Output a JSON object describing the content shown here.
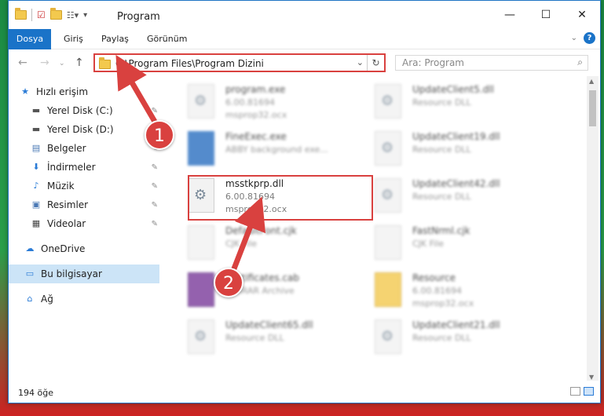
{
  "window": {
    "title": "Program"
  },
  "ribbon": {
    "tabs": [
      "Dosya",
      "Giriş",
      "Paylaş",
      "Görünüm"
    ]
  },
  "address": {
    "path": "C:\\Program Files\\Program Dizini"
  },
  "search": {
    "placeholder": "Ara: Program"
  },
  "sidebar": {
    "items": [
      {
        "label": "Hızlı erişim",
        "icon": "star-icon"
      },
      {
        "label": "Yerel Disk (C:)",
        "icon": "drive-icon"
      },
      {
        "label": "Yerel Disk (D:)",
        "icon": "drive-icon"
      },
      {
        "label": "Belgeler",
        "icon": "documents-icon"
      },
      {
        "label": "İndirmeler",
        "icon": "download-icon"
      },
      {
        "label": "Müzik",
        "icon": "music-icon"
      },
      {
        "label": "Resimler",
        "icon": "pictures-icon"
      },
      {
        "label": "Videolar",
        "icon": "video-icon"
      },
      {
        "label": "OneDrive",
        "icon": "cloud-icon"
      },
      {
        "label": "Bu bilgisayar",
        "icon": "computer-icon"
      },
      {
        "label": "Ağ",
        "icon": "network-icon"
      }
    ]
  },
  "files": [
    {
      "name": "program.exe",
      "line2": "6.00.81694",
      "line3": "msprop32.ocx"
    },
    {
      "name": "UpdateClient5.dll",
      "line2": "Resource DLL",
      "line3": ""
    },
    {
      "name": "FineExec.exe",
      "line2": "ABBY background exe...",
      "line3": ""
    },
    {
      "name": "UpdateClient19.dll",
      "line2": "Resource DLL",
      "line3": ""
    },
    {
      "name": "msstkprp.dll",
      "line2": "6.00.81694",
      "line3": "msprop32.ocx"
    },
    {
      "name": "UpdateClient42.dll",
      "line2": "Resource DLL",
      "line3": ""
    },
    {
      "name": "DefaultFont.cjk",
      "line2": "CJK File",
      "line3": ""
    },
    {
      "name": "FastNrml.cjk",
      "line2": "CJK File",
      "line3": ""
    },
    {
      "name": "Certificates.cab",
      "line2": "WinRAR Archive",
      "line3": ""
    },
    {
      "name": "Resource",
      "line2": "6.00.81694",
      "line3": "msprop32.ocx"
    },
    {
      "name": "UpdateClient65.dll",
      "line2": "Resource DLL",
      "line3": ""
    },
    {
      "name": "UpdateClient21.dll",
      "line2": "Resource DLL",
      "line3": ""
    }
  ],
  "status": {
    "count": "194 öğe"
  },
  "annotations": {
    "step1": "1",
    "step2": "2",
    "color": "#d9413f"
  }
}
